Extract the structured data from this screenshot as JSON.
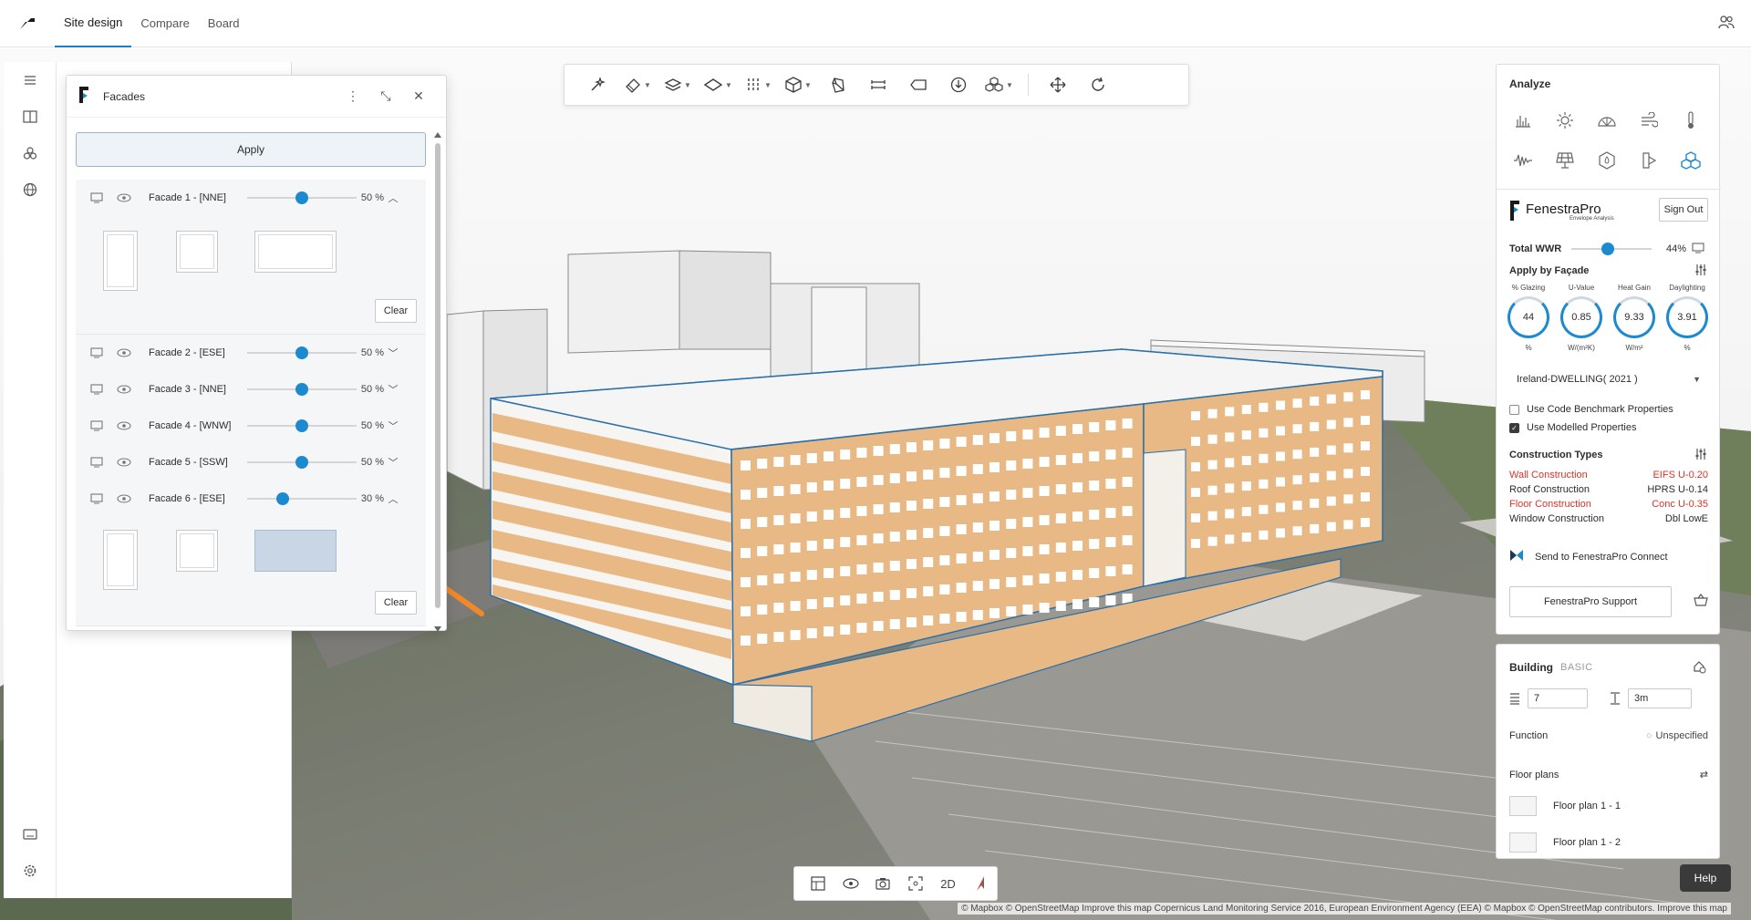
{
  "topbar": {
    "tabs": [
      "Site design",
      "Compare",
      "Board"
    ],
    "active_tab": "Site design"
  },
  "facades_panel": {
    "title": "Facades",
    "apply_label": "Apply",
    "clear_label": "Clear",
    "facades": [
      {
        "name": "Facade 1 - [NNE]",
        "percent_label": "50 %",
        "value": 0.5,
        "expanded": true
      },
      {
        "name": "Facade 2 - [ESE]",
        "percent_label": "50 %",
        "value": 0.5,
        "expanded": false
      },
      {
        "name": "Facade 3 - [NNE]",
        "percent_label": "50 %",
        "value": 0.5,
        "expanded": false
      },
      {
        "name": "Facade 4 - [WNW]",
        "percent_label": "50 %",
        "value": 0.5,
        "expanded": false
      },
      {
        "name": "Facade 5 - [SSW]",
        "percent_label": "50 %",
        "value": 0.5,
        "expanded": false
      },
      {
        "name": "Facade 6 - [ESE]",
        "percent_label": "30 %",
        "value": 0.3,
        "expanded": true
      }
    ]
  },
  "toolbar": {
    "icons": [
      "generate-icon",
      "paint-icon",
      "layers-icon",
      "plane-icon",
      "columns-icon",
      "box-icon",
      "solid-icon",
      "measure-icon",
      "tag-icon",
      "download-icon",
      "group-icon",
      "move-icon",
      "rotate-icon"
    ]
  },
  "bottom_toolbar": {
    "view_2d": "2D"
  },
  "analyze": {
    "title": "Analyze",
    "brand": "FenestraPro",
    "brand_sub": "Envelope Analysis",
    "sign_out": "Sign Out",
    "total_wwr_label": "Total WWR",
    "total_wwr_value": "44%",
    "total_wwr_fraction": 0.44,
    "apply_by_facade": "Apply by Façade",
    "gauges": [
      {
        "label": "% Glazing",
        "value": "44",
        "unit": "%"
      },
      {
        "label": "U-Value",
        "value": "0.85",
        "unit": "W/(m²K)"
      },
      {
        "label": "Heat Gain",
        "value": "9.33",
        "unit": "W/m²"
      },
      {
        "label": "Daylighting",
        "value": "3.91",
        "unit": "%"
      }
    ],
    "benchmark": "Ireland-DWELLING( 2021 )",
    "use_code_benchmark": "Use Code Benchmark Properties",
    "use_modelled": "Use Modelled Properties",
    "construction_types_title": "Construction Types",
    "construction_types": [
      {
        "name": "Wall Construction",
        "value": "EIFS U-0.20",
        "warn": true
      },
      {
        "name": "Roof Construction",
        "value": "HPRS U-0.14",
        "warn": false
      },
      {
        "name": "Floor Construction",
        "value": "Conc U-0.35",
        "warn": true
      },
      {
        "name": "Window Construction",
        "value": "Dbl LowE",
        "warn": false
      }
    ],
    "send_label": "Send to FenestraPro Connect",
    "support_label": "FenestraPro Support"
  },
  "building": {
    "title": "Building",
    "mode": "BASIC",
    "floors": "7",
    "height": "3m",
    "function_label": "Function",
    "function_value": "Unspecified",
    "floor_plans_label": "Floor plans",
    "floor_plans": [
      "Floor plan 1 - 1",
      "Floor plan 1 - 2"
    ]
  },
  "help_label": "Help",
  "attribution": "© Mapbox © OpenStreetMap Improve this map Copernicus Land Monitoring Service 2016, European Environment Agency (EEA) © Mapbox © OpenStreetMap contributors. Improve this map",
  "colors": {
    "accent": "#1d8ad0",
    "facade": "#e9b985",
    "warning": "#d8352a",
    "arrow": "#f0892a"
  }
}
